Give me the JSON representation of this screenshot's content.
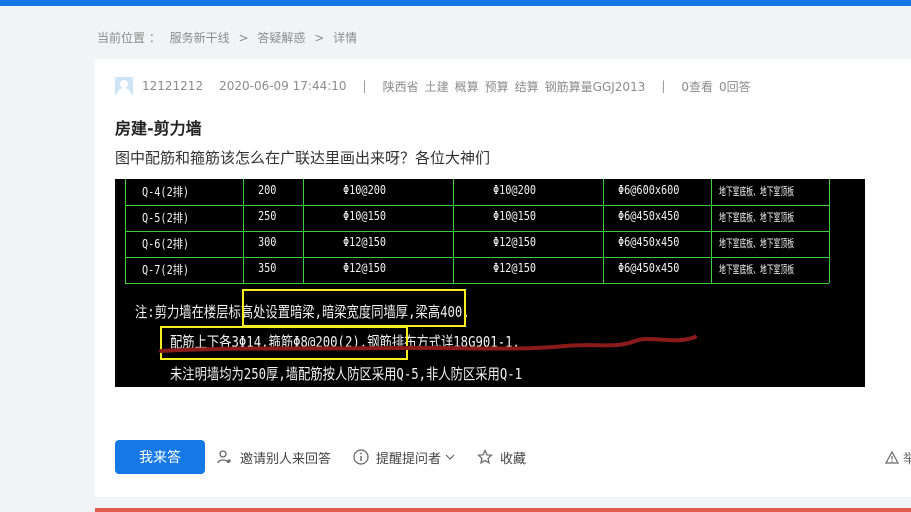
{
  "breadcrumb": {
    "label": "当前位置 ：",
    "items": [
      "服务新干线",
      ">",
      "答疑解惑",
      ">",
      "详情"
    ]
  },
  "meta": {
    "username": "12121212",
    "datetime": "2020-06-09 17:44:10",
    "sep": "|",
    "tags": [
      "陕西省",
      "土建",
      "概算",
      "预算",
      "结算",
      "钢筋算量GGJ2013"
    ],
    "views": "0查看",
    "answers": "0回答"
  },
  "question": {
    "title": "房建-剪力墙",
    "body": "图中配筋和箍筋该怎么在广联达里画出来呀？各位大神们"
  },
  "cad": {
    "rows": [
      [
        "Q-4(2排)",
        "200",
        "Φ10@200",
        "Φ10@200",
        "Φ6@600x600",
        "地下室底板、地下室顶板"
      ],
      [
        "Q-5(2排)",
        "250",
        "Φ10@150",
        "Φ10@150",
        "Φ6@450x450",
        "地下室底板、地下室顶板"
      ],
      [
        "Q-6(2排)",
        "300",
        "Φ12@150",
        "Φ12@150",
        "Φ6@450x450",
        "地下室底板、地下室顶板"
      ],
      [
        "Q-7(2排)",
        "350",
        "Φ12@150",
        "Φ12@150",
        "Φ6@450x450",
        "地下室底板、地下室顶板"
      ]
    ],
    "notes": [
      "注:剪力墙在楼层标高处设置暗梁,暗梁宽度同墙厚,梁高400.",
      "配筋上下各3Φ14,箍筋Φ8@200(2).钢筋排布方式详18G901-1.",
      "未注明墙均为250厚,墙配筋按人防区采用Q-5,非人防区采用Q-1"
    ],
    "highlight_color": "#f4ee22",
    "underline_color": "#8b1a1a",
    "grid_color": "#3ccf3c"
  },
  "actions": {
    "answer_button": "我来答",
    "invite": "邀请别人来回答",
    "remind": "提醒提问者",
    "favorite": "收藏",
    "report": "举"
  },
  "colors": {
    "primary": "#1677e6",
    "page_bg": "#f2f3f5"
  }
}
